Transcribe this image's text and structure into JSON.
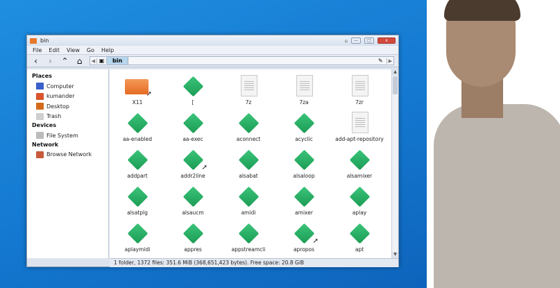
{
  "window": {
    "title": "bin",
    "buttons": {
      "minimize": "—",
      "maximize": "□",
      "close": "x"
    }
  },
  "menu": [
    "File",
    "Edit",
    "View",
    "Go",
    "Help"
  ],
  "path": {
    "crumb": "bin"
  },
  "sidebar": {
    "sections": [
      {
        "title": "Places",
        "items": [
          {
            "label": "Computer",
            "color": "#3a5fc8"
          },
          {
            "label": "kumander",
            "color": "#d9542a"
          },
          {
            "label": "Desktop",
            "color": "#d46a1a"
          },
          {
            "label": "Trash",
            "color": "#cfcfcf"
          }
        ]
      },
      {
        "title": "Devices",
        "items": [
          {
            "label": "File System",
            "color": "#bbbbbb"
          }
        ]
      },
      {
        "title": "Network",
        "items": [
          {
            "label": "Browse Network",
            "color": "#c85a3a"
          }
        ]
      }
    ]
  },
  "files": [
    {
      "name": "X11",
      "type": "folder"
    },
    {
      "name": "[",
      "type": "exec"
    },
    {
      "name": "7z",
      "type": "doc"
    },
    {
      "name": "7za",
      "type": "doc"
    },
    {
      "name": "7zr",
      "type": "doc"
    },
    {
      "name": "aa-enabled",
      "type": "exec"
    },
    {
      "name": "aa-exec",
      "type": "exec"
    },
    {
      "name": "aconnect",
      "type": "exec"
    },
    {
      "name": "acyclic",
      "type": "exec"
    },
    {
      "name": "add-apt-repository",
      "type": "doc"
    },
    {
      "name": "addpart",
      "type": "exec"
    },
    {
      "name": "addr2line",
      "type": "exec",
      "link": true
    },
    {
      "name": "alsabat",
      "type": "exec"
    },
    {
      "name": "alsaloop",
      "type": "exec"
    },
    {
      "name": "alsamixer",
      "type": "exec"
    },
    {
      "name": "alsatplg",
      "type": "exec"
    },
    {
      "name": "alsaucm",
      "type": "exec"
    },
    {
      "name": "amidi",
      "type": "exec"
    },
    {
      "name": "amixer",
      "type": "exec"
    },
    {
      "name": "aplay",
      "type": "exec"
    },
    {
      "name": "aplaymidi",
      "type": "exec"
    },
    {
      "name": "appres",
      "type": "exec"
    },
    {
      "name": "appstreamcli",
      "type": "exec"
    },
    {
      "name": "apropos",
      "type": "exec",
      "link": true
    },
    {
      "name": "apt",
      "type": "exec"
    }
  ],
  "status": "1 folder, 1372 files: 351.6 MiB (368,651,423 bytes). Free space: 20.8 GiB"
}
